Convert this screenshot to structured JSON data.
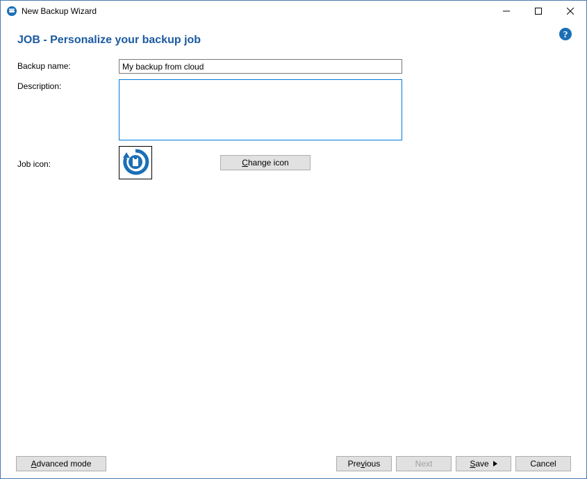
{
  "window": {
    "title": "New Backup Wizard"
  },
  "page": {
    "heading": "JOB - Personalize your backup job"
  },
  "labels": {
    "backup_name": "Backup name:",
    "description": "Description:",
    "job_icon": "Job icon:"
  },
  "fields": {
    "backup_name_value": "My backup from cloud",
    "description_value": ""
  },
  "buttons": {
    "change_icon_pre": "",
    "change_icon_u": "C",
    "change_icon_post": "hange icon",
    "advanced_pre": "",
    "advanced_u": "A",
    "advanced_post": "dvanced mode",
    "previous_pre": "Pre",
    "previous_u": "v",
    "previous_post": "ious",
    "next_pre": "",
    "next_u": "N",
    "next_post": "ext",
    "save_pre": "",
    "save_u": "S",
    "save_post": "ave",
    "cancel": "Cancel"
  }
}
